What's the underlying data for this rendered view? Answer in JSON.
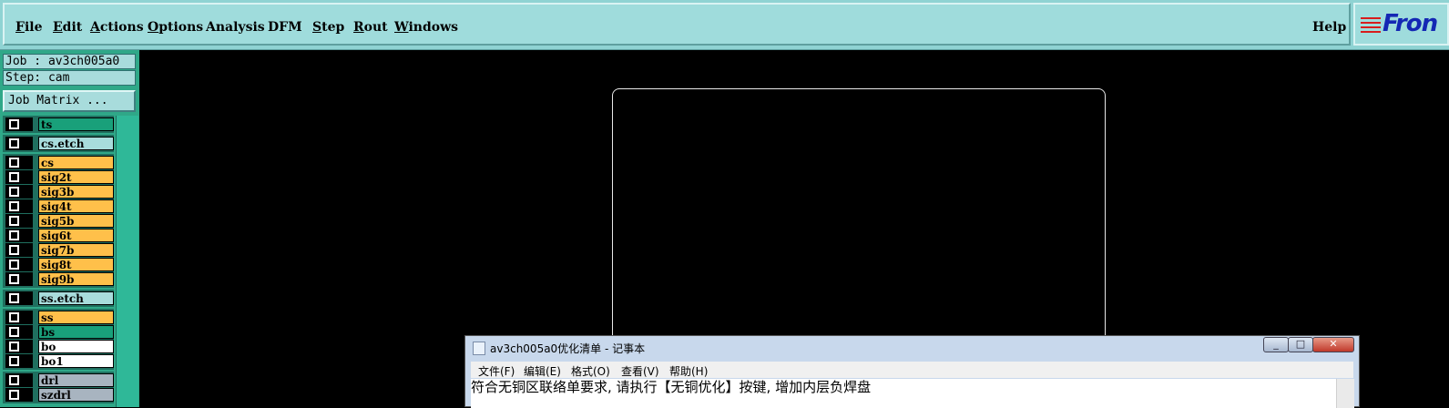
{
  "menubar": {
    "items": [
      {
        "label": "File",
        "hot": "F",
        "rest": "ile"
      },
      {
        "label": "Edit",
        "hot": "E",
        "rest": "dit"
      },
      {
        "label": "Actions",
        "hot": "A",
        "rest": "ctions"
      },
      {
        "label": "Options",
        "hot": "O",
        "rest": "ptions"
      },
      {
        "label": "Analysis",
        "hot": "",
        "rest": "Analysis"
      },
      {
        "label": "DFM",
        "hot": "",
        "rest": "DFM"
      },
      {
        "label": "Step",
        "hot": "S",
        "rest": "tep"
      },
      {
        "label": "Rout",
        "hot": "R",
        "rest": "out"
      },
      {
        "label": "Windows",
        "hot": "W",
        "rest": "indows"
      }
    ],
    "help": "Help",
    "logo_text": "Fron"
  },
  "panel": {
    "job": "Job : av3ch005a0",
    "step": "Step: cam",
    "job_matrix": "Job Matrix ..."
  },
  "layers": [
    {
      "name": "ts",
      "color": "#19a07a",
      "text": "#000"
    },
    {
      "name": "cs.etch",
      "color": "#a8dcdc",
      "text": "#000"
    },
    {
      "name": "cs",
      "color": "#ffc04a",
      "text": "#000"
    },
    {
      "name": "sig2t",
      "color": "#ffc04a",
      "text": "#000"
    },
    {
      "name": "sig3b",
      "color": "#ffc04a",
      "text": "#000"
    },
    {
      "name": "sig4t",
      "color": "#ffc04a",
      "text": "#000"
    },
    {
      "name": "sig5b",
      "color": "#ffc04a",
      "text": "#000"
    },
    {
      "name": "sig6t",
      "color": "#ffc04a",
      "text": "#000"
    },
    {
      "name": "sig7b",
      "color": "#ffc04a",
      "text": "#000"
    },
    {
      "name": "sig8t",
      "color": "#ffc04a",
      "text": "#000"
    },
    {
      "name": "sig9b",
      "color": "#ffc04a",
      "text": "#000"
    },
    {
      "name": "ss.etch",
      "color": "#a8dcdc",
      "text": "#000"
    },
    {
      "name": "ss",
      "color": "#ffc04a",
      "text": "#000"
    },
    {
      "name": "bs",
      "color": "#19a07a",
      "text": "#000"
    },
    {
      "name": "bo",
      "color": "#ffffff",
      "text": "#000"
    },
    {
      "name": "bo1",
      "color": "#ffffff",
      "text": "#000"
    },
    {
      "name": "drl",
      "color": "#a8b4c0",
      "text": "#000"
    },
    {
      "name": "szdrl",
      "color": "#a8b4c0",
      "text": "#000"
    }
  ],
  "notepad": {
    "title": "av3ch005a0优化清单 - 记事本",
    "menus": [
      "文件(F)",
      "编辑(E)",
      "格式(O)",
      "查看(V)",
      "帮助(H)"
    ],
    "line1": "符合无铜区联络单要求, 请执行【无铜优化】按键, 增加内层负焊盘",
    "line2": ""
  }
}
